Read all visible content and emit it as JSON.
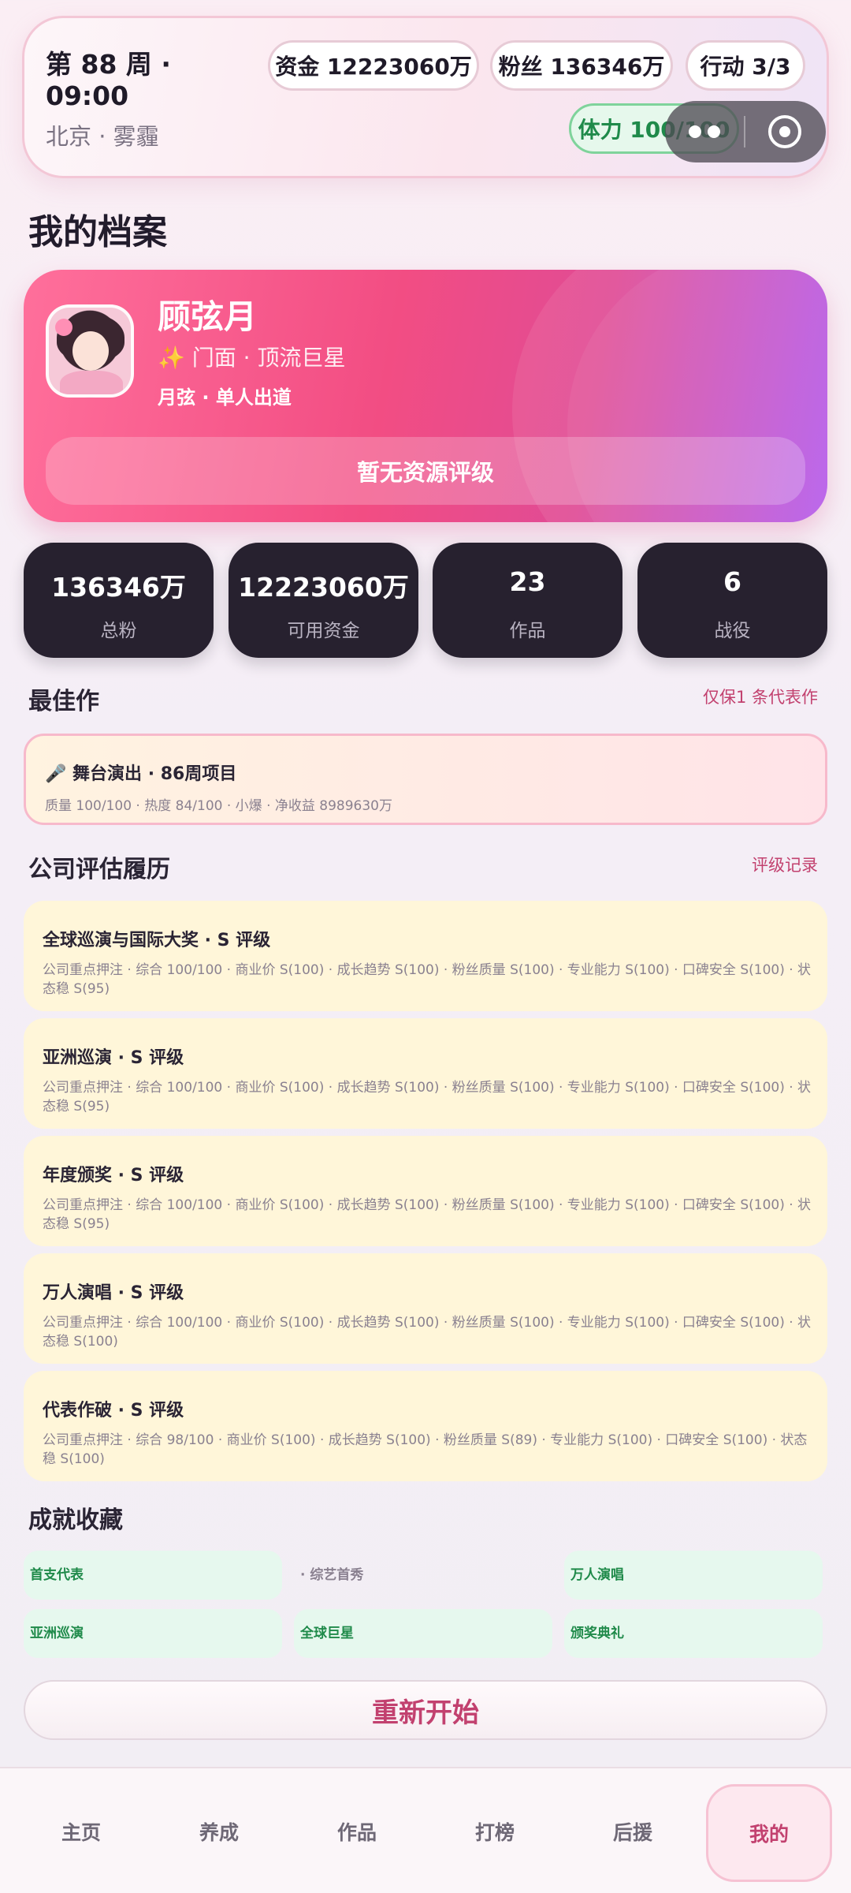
{
  "status": {
    "week": "第 88 周 · 09:00",
    "location": "北京 · 雾霾",
    "funds": "资金 12223060万",
    "fans": "粉丝 136346万",
    "actions": "行动 3/3",
    "stamina": "体力 100/100"
  },
  "page": {
    "title": "我的档案"
  },
  "profile": {
    "name": "顾弦月",
    "role": "✨ 门面 · 顶流巨星",
    "group": "月弦 · 单人出道",
    "rating": "暂无资源评级"
  },
  "stats": [
    {
      "value": "136346万",
      "label": "总粉"
    },
    {
      "value": "12223060万",
      "label": "可用资金"
    },
    {
      "value": "23",
      "label": "作品"
    },
    {
      "value": "6",
      "label": "战役"
    }
  ],
  "best_work": {
    "section_title": "最佳作",
    "link": "仅保1 条代表作",
    "title": "🎤 舞台演出 · 86周项目",
    "meta": "质量 100/100 · 热度 84/100 · 小爆 · 净收益 8989630万"
  },
  "evaluation": {
    "section_title": "公司评估履历",
    "link": "评级记录",
    "items": [
      {
        "title": "全球巡演与国际大奖 · S 评级",
        "desc": "公司重点押注 · 综合 100/100 · 商业价 S(100) · 成长趋势 S(100) · 粉丝质量 S(100) · 专业能力 S(100) · 口碑安全 S(100) · 状态稳 S(95)"
      },
      {
        "title": "亚洲巡演 · S 评级",
        "desc": "公司重点押注 · 综合 100/100 · 商业价 S(100) · 成长趋势 S(100) · 粉丝质量 S(100) · 专业能力 S(100) · 口碑安全 S(100) · 状态稳 S(95)"
      },
      {
        "title": "年度颁奖 · S 评级",
        "desc": "公司重点押注 · 综合 100/100 · 商业价 S(100) · 成长趋势 S(100) · 粉丝质量 S(100) · 专业能力 S(100) · 口碑安全 S(100) · 状态稳 S(95)"
      },
      {
        "title": "万人演唱 · S 评级",
        "desc": "公司重点押注 · 综合 100/100 · 商业价 S(100) · 成长趋势 S(100) · 粉丝质量 S(100) · 专业能力 S(100) · 口碑安全 S(100) · 状态稳 S(100)"
      },
      {
        "title": "代表作破 · S 评级",
        "desc": "公司重点押注 · 综合 98/100 · 商业价 S(100) · 成长趋势 S(100) · 粉丝质量 S(89) · 专业能力 S(100) · 口碑安全 S(100) · 状态稳 S(100)"
      }
    ]
  },
  "achievements": {
    "section_title": "成就收藏",
    "items": [
      {
        "label": "首支代表",
        "unlocked": true
      },
      {
        "label": "· 综艺首秀",
        "unlocked": false
      },
      {
        "label": "万人演唱",
        "unlocked": true
      },
      {
        "label": "亚洲巡演",
        "unlocked": true
      },
      {
        "label": "全球巨星",
        "unlocked": true
      },
      {
        "label": "颁奖典礼",
        "unlocked": true
      }
    ]
  },
  "restart_label": "重新开始",
  "nav": {
    "items": [
      "主页",
      "养成",
      "作品",
      "打榜",
      "后援",
      "我的"
    ],
    "active": "我的"
  },
  "colors": {
    "accent": "#c2416f",
    "profile_gradient_start": "#ff6f9b",
    "profile_gradient_end": "#b152ea",
    "stat_tile": "#27212f",
    "eval_card": "#fff6d9",
    "achievement_unlocked": "#e6f8ee"
  }
}
